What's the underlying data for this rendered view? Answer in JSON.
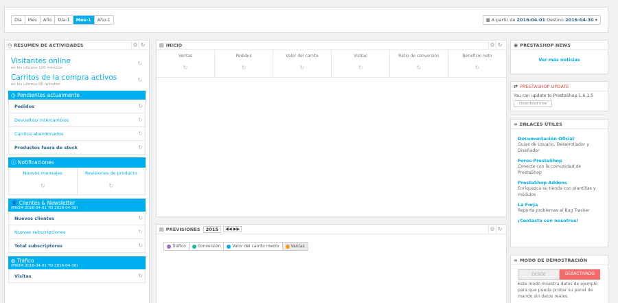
{
  "topbar": {
    "ranges": [
      "Día",
      "Mes",
      "Año",
      "Día-1",
      "Mes-1",
      "Año-1"
    ],
    "active_range": "Mes-1",
    "date_prefix": "A partir de",
    "date_from": "2016-04-01",
    "date_mid": "Destino",
    "date_to": "2016-04-30"
  },
  "activity": {
    "title": "RESUMEN DE ACTIVIDADES",
    "visitors_title": "Visitantes online",
    "visitors_sub": "en los últimos 120 minutos",
    "carts_title": "Carritos de la compra activos",
    "carts_sub": "en los últimos 60 minutos",
    "pending_header": "Pendientes actualmente",
    "pending_items": [
      "Pedidos",
      "Devueltos/ Intercambios",
      "Carritos abandonados",
      "Productos fuera de stock"
    ],
    "notif_header": "Notificaciones",
    "notif_items": [
      "Nuevos mensajes",
      "Revisiones de producto"
    ],
    "clients_header": "Clientes & Newsletter",
    "clients_range": "(FROM 2016-04-01 TO 2016-04-30)",
    "clients_items": [
      "Nuevos clientes",
      "Nuevas subscripciones",
      "Total subscriptores"
    ],
    "traffic_header": "Tráfico",
    "traffic_range": "(FROM 2016-04-01 TO 2016-04-30)",
    "traffic_items": [
      "Visitas"
    ]
  },
  "inicio": {
    "title": "INICIO",
    "kpis": [
      "Ventas",
      "Pedidos",
      "Valor del carrito",
      "Visitas",
      "Ratio de conversión",
      "Beneficio neto"
    ]
  },
  "previsiones": {
    "title": "PREVISIONES",
    "year": "2015",
    "legend": [
      {
        "label": "Tráfico",
        "color": "#a569bd"
      },
      {
        "label": "Conversión",
        "color": "#1abc9c"
      },
      {
        "label": "Valor del carrito medio",
        "color": "#00aff0"
      },
      {
        "label": "Ventas",
        "color": "#f39c12"
      }
    ]
  },
  "news": {
    "title": "PRESTASHOP NEWS",
    "link": "Ver más noticias"
  },
  "update": {
    "title": "PRESTASHOP UPDATE",
    "text": "You can update to PrestaShop 1.6.1.5",
    "button": "Download now"
  },
  "links": {
    "title": "ENLACES ÚTILES",
    "items": [
      {
        "title": "Documentación Oficial",
        "desc": "Guías de Usuario, Desarrollador y Diseñador"
      },
      {
        "title": "Foros PrestaShop",
        "desc": "Conecte con la comunidad de PrestaShop"
      },
      {
        "title": "PrestaShop Addons",
        "desc": "Enriquezca su tienda con plantillas y módulos"
      },
      {
        "title": "La Forja",
        "desc": "Reporta problemas al Bug Tracker"
      },
      {
        "title": "¡Contacta con nosotros!",
        "desc": ""
      }
    ]
  },
  "demo": {
    "title": "MODO DE DEMOSTRACIÓN",
    "off_label": "DESDE",
    "on_label": "DESACTIVADO",
    "text": "Este modo muestra datos de ejemplo para que pueda probar su panel de mando sin datos reales."
  }
}
